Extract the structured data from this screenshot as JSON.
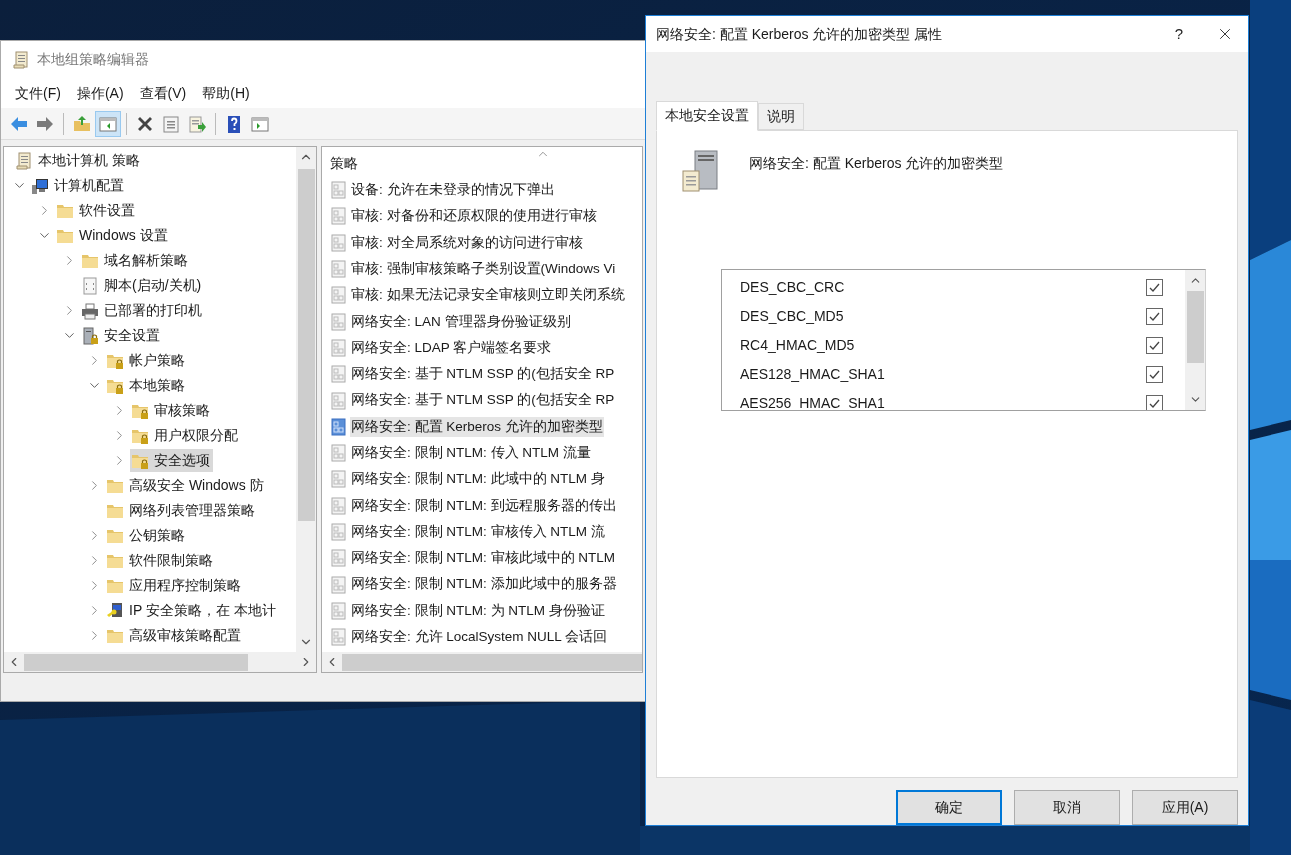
{
  "main_window": {
    "title": "本地组策略编辑器",
    "menu": [
      "文件(F)",
      "操作(A)",
      "查看(V)",
      "帮助(H)"
    ],
    "toolbar": [
      [
        {
          "kind": "back",
          "pressed": false
        },
        {
          "kind": "forward",
          "pressed": false
        }
      ],
      [
        {
          "kind": "up",
          "pressed": false
        },
        {
          "kind": "console-tree",
          "pressed": true
        }
      ],
      [
        {
          "kind": "delete",
          "pressed": false
        },
        {
          "kind": "properties",
          "pressed": false
        },
        {
          "kind": "export",
          "pressed": false
        }
      ],
      [
        {
          "kind": "help",
          "pressed": false
        },
        {
          "kind": "view",
          "pressed": false
        }
      ]
    ],
    "tree": {
      "label": "本地计算机 策略",
      "kind": "scroll",
      "selected": false,
      "children": [
        {
          "label": "计算机配置",
          "kind": "computer",
          "selected": false,
          "expanded": true,
          "children": [
            {
              "label": "软件设置",
              "kind": "folder",
              "selected": false,
              "expanded": false
            },
            {
              "label": "Windows 设置",
              "kind": "folder",
              "selected": false,
              "expanded": true,
              "children": [
                {
                  "label": "域名解析策略",
                  "kind": "folder",
                  "selected": false,
                  "expanded": false
                },
                {
                  "label": "脚本(启动/关机)",
                  "kind": "script",
                  "selected": false
                },
                {
                  "label": "已部署的打印机",
                  "kind": "printer",
                  "selected": false,
                  "expanded": false
                },
                {
                  "label": "安全设置",
                  "kind": "server",
                  "selected": false,
                  "expanded": true,
                  "children": [
                    {
                      "label": "帐户策略",
                      "kind": "secure-folder",
                      "selected": false,
                      "expanded": false
                    },
                    {
                      "label": "本地策略",
                      "kind": "secure-folder",
                      "selected": false,
                      "expanded": true,
                      "children": [
                        {
                          "label": "审核策略",
                          "kind": "secure-folder",
                          "selected": false,
                          "expanded": false
                        },
                        {
                          "label": "用户权限分配",
                          "kind": "secure-folder",
                          "selected": false,
                          "expanded": false
                        },
                        {
                          "label": "安全选项",
                          "kind": "secure-folder",
                          "selected": true,
                          "expanded": false
                        }
                      ]
                    },
                    {
                      "label": "高级安全 Windows 防",
                      "kind": "folder",
                      "selected": false,
                      "expanded": false
                    },
                    {
                      "label": "网络列表管理器策略",
                      "kind": "folder",
                      "selected": false
                    },
                    {
                      "label": "公钥策略",
                      "kind": "folder",
                      "selected": false,
                      "expanded": false
                    },
                    {
                      "label": "软件限制策略",
                      "kind": "folder",
                      "selected": false,
                      "expanded": false
                    },
                    {
                      "label": "应用程序控制策略",
                      "kind": "folder",
                      "selected": false,
                      "expanded": false
                    },
                    {
                      "label": "IP 安全策略，在 本地计",
                      "kind": "ip-policy",
                      "selected": false,
                      "expanded": false
                    },
                    {
                      "label": "高级审核策略配置",
                      "kind": "folder",
                      "selected": false,
                      "expanded": false
                    }
                  ]
                }
              ]
            }
          ]
        }
      ]
    },
    "list": {
      "column": "策略",
      "rows": [
        {
          "label": "设备: 允许在未登录的情况下弹出",
          "selected": false
        },
        {
          "label": "审核: 对备份和还原权限的使用进行审核",
          "selected": false
        },
        {
          "label": "审核: 对全局系统对象的访问进行审核",
          "selected": false
        },
        {
          "label": "审核: 强制审核策略子类别设置(Windows Vi",
          "selected": false
        },
        {
          "label": "审核: 如果无法记录安全审核则立即关闭系统",
          "selected": false
        },
        {
          "label": "网络安全: LAN 管理器身份验证级别",
          "selected": false
        },
        {
          "label": "网络安全: LDAP 客户端签名要求",
          "selected": false
        },
        {
          "label": "网络安全: 基于 NTLM SSP 的(包括安全 RP",
          "selected": false
        },
        {
          "label": "网络安全: 基于 NTLM SSP 的(包括安全 RP",
          "selected": false
        },
        {
          "label": "网络安全: 配置 Kerberos 允许的加密类型",
          "selected": true
        },
        {
          "label": "网络安全: 限制 NTLM: 传入 NTLM 流量",
          "selected": false
        },
        {
          "label": "网络安全: 限制 NTLM: 此域中的 NTLM 身",
          "selected": false
        },
        {
          "label": "网络安全: 限制 NTLM: 到远程服务器的传出",
          "selected": false
        },
        {
          "label": "网络安全: 限制 NTLM: 审核传入 NTLM 流",
          "selected": false
        },
        {
          "label": "网络安全: 限制 NTLM: 审核此域中的 NTLM",
          "selected": false
        },
        {
          "label": "网络安全: 限制 NTLM: 添加此域中的服务器",
          "selected": false
        },
        {
          "label": "网络安全: 限制 NTLM: 为 NTLM 身份验证",
          "selected": false
        },
        {
          "label": "网络安全: 允许 LocalSystem NULL 会话回",
          "selected": false
        }
      ]
    }
  },
  "dialog": {
    "title": "网络安全: 配置 Kerberos 允许的加密类型 属性",
    "help": "?",
    "tabs": [
      {
        "label": "本地安全设置",
        "selected": true
      },
      {
        "label": "说明",
        "selected": false
      }
    ],
    "heading": "网络安全: 配置 Kerberos 允许的加密类型",
    "options": [
      {
        "label": "DES_CBC_CRC",
        "checked": true
      },
      {
        "label": "DES_CBC_MD5",
        "checked": true
      },
      {
        "label": "RC4_HMAC_MD5",
        "checked": true
      },
      {
        "label": "AES128_HMAC_SHA1",
        "checked": true
      },
      {
        "label": "AES256_HMAC_SHA1",
        "checked": true
      }
    ],
    "buttons": [
      {
        "label": "确定",
        "default": true
      },
      {
        "label": "取消",
        "default": false
      },
      {
        "label": "应用(A)",
        "default": false
      }
    ]
  }
}
